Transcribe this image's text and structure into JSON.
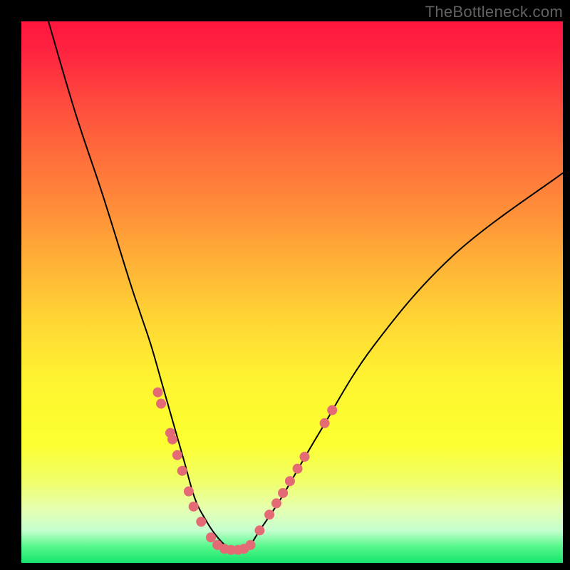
{
  "watermark": "TheBottleneck.com",
  "chart_data": {
    "type": "line",
    "title": "",
    "xlabel": "",
    "ylabel": "",
    "xlim": [
      0,
      100
    ],
    "ylim": [
      0,
      100
    ],
    "series": [
      {
        "name": "curve",
        "x": [
          5,
          10,
          15,
          20,
          22,
          24,
          26,
          28,
          30,
          32,
          34,
          36,
          38,
          40,
          42,
          44,
          48,
          55,
          65,
          80,
          100
        ],
        "y": [
          100,
          83,
          68,
          52,
          46,
          40,
          33,
          26,
          19,
          12,
          8,
          5,
          3,
          2.4,
          3,
          6,
          12,
          24,
          40,
          57,
          72
        ],
        "stroke": "#000000",
        "stroke_width": 2
      }
    ],
    "markers": {
      "color": "#e46a75",
      "radius": 7,
      "points": [
        {
          "x": 25.2,
          "y": 31.5
        },
        {
          "x": 25.8,
          "y": 29.4
        },
        {
          "x": 27.5,
          "y": 24.0
        },
        {
          "x": 27.9,
          "y": 22.8
        },
        {
          "x": 28.8,
          "y": 19.9
        },
        {
          "x": 29.7,
          "y": 17.0
        },
        {
          "x": 30.9,
          "y": 13.2
        },
        {
          "x": 31.8,
          "y": 10.4
        },
        {
          "x": 33.2,
          "y": 7.6
        },
        {
          "x": 35.0,
          "y": 4.7
        },
        {
          "x": 36.2,
          "y": 3.3
        },
        {
          "x": 37.5,
          "y": 2.6
        },
        {
          "x": 38.7,
          "y": 2.4
        },
        {
          "x": 40.0,
          "y": 2.4
        },
        {
          "x": 41.1,
          "y": 2.6
        },
        {
          "x": 42.3,
          "y": 3.3
        },
        {
          "x": 44.0,
          "y": 6.0
        },
        {
          "x": 45.8,
          "y": 8.9
        },
        {
          "x": 47.1,
          "y": 11.0
        },
        {
          "x": 48.3,
          "y": 12.9
        },
        {
          "x": 49.6,
          "y": 15.1
        },
        {
          "x": 51.0,
          "y": 17.4
        },
        {
          "x": 52.3,
          "y": 19.6
        },
        {
          "x": 56.0,
          "y": 25.8
        },
        {
          "x": 57.4,
          "y": 28.2
        }
      ]
    },
    "grid": false,
    "legend": false
  }
}
